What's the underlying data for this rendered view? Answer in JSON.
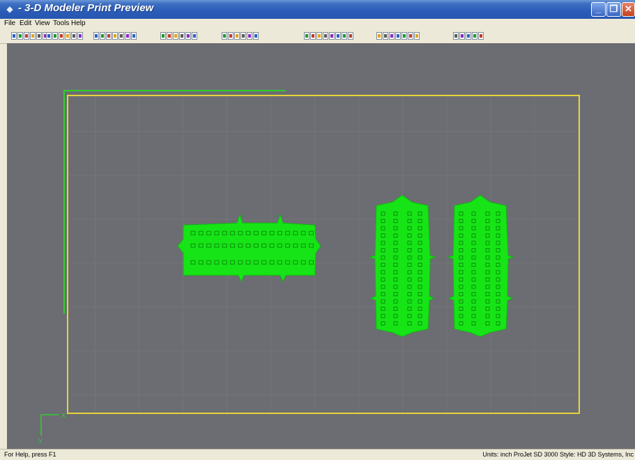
{
  "window": {
    "title": "3-D Modeler Print Preview",
    "title_prefix": "-"
  },
  "menu": [
    "File",
    "Edit",
    "View",
    "Tools",
    "Help"
  ],
  "toolbar": {
    "icons": [
      "print-icon",
      "print-setup-icon",
      "open-icon",
      "save-icon",
      "undo-icon",
      "redo-icon",
      "build-icon",
      "layout-icon",
      "zoom-in-icon",
      "zoom-out-icon",
      "stop-icon",
      "pause-icon",
      "view-front-icon",
      "view-back-icon",
      "view-top-icon",
      "move-icon",
      "view-left-icon",
      "view-right-icon",
      "view-iso-icon",
      "rotate-x-icon",
      "rotate-y-icon",
      "rotate-z-icon",
      "rotate-free-icon",
      "scale-icon",
      "mirror-icon",
      "select-all-icon",
      "grid-icon",
      "snap-icon",
      "measure-icon",
      "color-icon",
      "shade-icon",
      "arrange-icon",
      "align-left-icon",
      "align-center-icon",
      "align-right-icon",
      "distribute-icon",
      "group-icon",
      "ungroup-icon",
      "properties-icon",
      "info-icon",
      "layer-icon",
      "help-icon"
    ]
  },
  "colors": {
    "viewport_bg": "#6c6d72",
    "platform_border": "#e8d43a",
    "part_fill": "#16e416",
    "axis": "#2ed12e"
  },
  "axis": {
    "x_label": "X",
    "y_label": "Y"
  },
  "status": {
    "help": "For Help, press F1",
    "info": "Units: inch ProJet SD 3000 Style: HD 3D Systems, Inc"
  }
}
